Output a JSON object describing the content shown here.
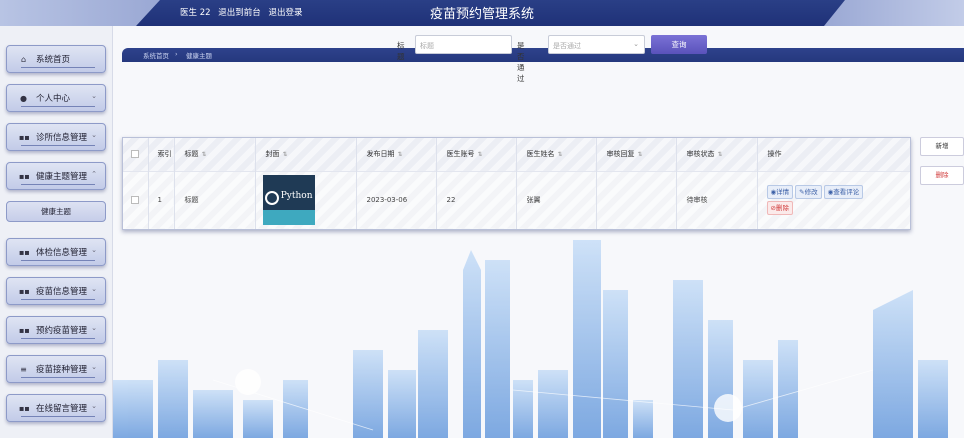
{
  "header": {
    "user": "医生 22",
    "back_link": "退出到前台",
    "logout_link": "退出登录",
    "title": "疫苗预约管理系统"
  },
  "sidebar": {
    "items": [
      {
        "label": "系统首页",
        "icon": "home-icon"
      },
      {
        "label": "个人中心",
        "icon": "user-icon"
      },
      {
        "label": "诊所信息管理",
        "icon": "grid-icon"
      },
      {
        "label": "健康主题管理",
        "icon": "grid-icon"
      },
      {
        "label": "体检信息管理",
        "icon": "grid-icon"
      },
      {
        "label": "疫苗信息管理",
        "icon": "grid-icon"
      },
      {
        "label": "预约疫苗管理",
        "icon": "grid-icon"
      },
      {
        "label": "疫苗接种管理",
        "icon": "sliders-icon"
      },
      {
        "label": "在线留言管理",
        "icon": "grid-icon"
      }
    ],
    "submenu": "健康主题"
  },
  "breadcrumb": {
    "home": "系统首页",
    "sep": "›",
    "current": "健康主题"
  },
  "search": {
    "title_label": "标题",
    "title_placeholder": "标题",
    "review_label": "是否通过",
    "review_placeholder": "是否通过",
    "button": "查询"
  },
  "actions": {
    "add": "新增",
    "delete": "删除"
  },
  "table": {
    "headers": [
      "索引",
      "标题",
      "封面",
      "发布日期",
      "医生账号",
      "医生姓名",
      "审核回复",
      "审核状态",
      "操作"
    ],
    "rows": [
      {
        "index": "1",
        "title": "标题",
        "cover_text": "Python",
        "date": "2023-03-06",
        "doctor_account": "22",
        "doctor_name": "张翼",
        "reply": "",
        "status": "待审核"
      }
    ],
    "row_ops": {
      "detail": "详情",
      "edit": "修改",
      "comments": "查看评论",
      "delete": "删除"
    }
  },
  "colors": {
    "header_bg": "#1f3178",
    "accent": "#5a52bb",
    "delete": "#d03a3a"
  }
}
